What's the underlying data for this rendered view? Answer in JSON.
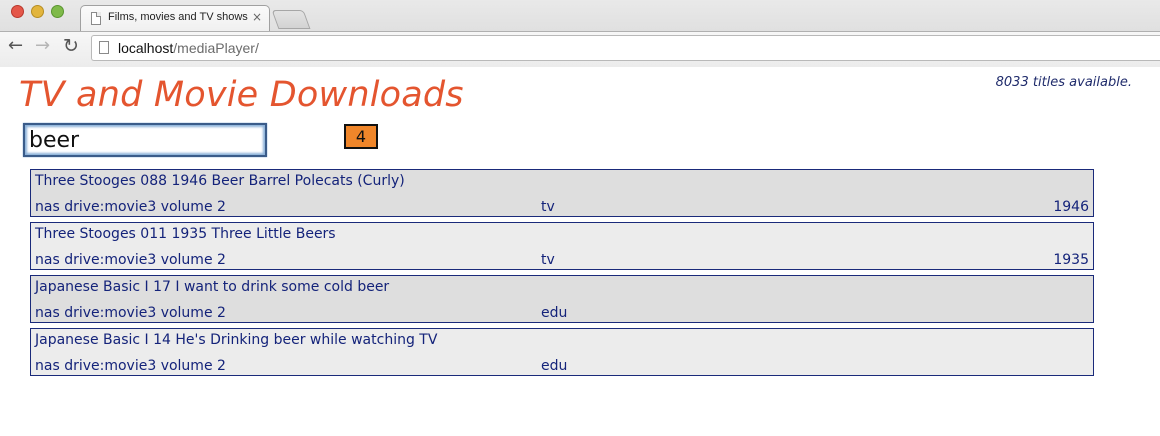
{
  "browser": {
    "tab_title": "Films, movies and TV shows",
    "tab_close": "×",
    "url_host": "localhost",
    "url_path": "/mediaPlayer/",
    "back_icon": "←",
    "forward_icon": "→",
    "reload_icon": "↻"
  },
  "page": {
    "title": "TV and Movie Downloads",
    "titles_available": "8033 titles available.",
    "search_value": "beer",
    "result_count": "4",
    "accent_color": "#e4552f",
    "badge_color": "#f0862a"
  },
  "results": [
    {
      "title": "Three Stooges 088 1946 Beer Barrel Polecats (Curly)",
      "drive": "nas drive:movie3 volume 2",
      "type": "tv",
      "year": "1946"
    },
    {
      "title": "Three Stooges 011 1935 Three Little Beers",
      "drive": "nas drive:movie3 volume 2",
      "type": "tv",
      "year": "1935"
    },
    {
      "title": "Japanese Basic I 17 I want to drink some cold beer",
      "drive": "nas drive:movie3 volume 2",
      "type": "edu",
      "year": ""
    },
    {
      "title": "Japanese Basic I 14 He's Drinking beer while watching TV",
      "drive": "nas drive:movie3 volume 2",
      "type": "edu",
      "year": ""
    }
  ]
}
